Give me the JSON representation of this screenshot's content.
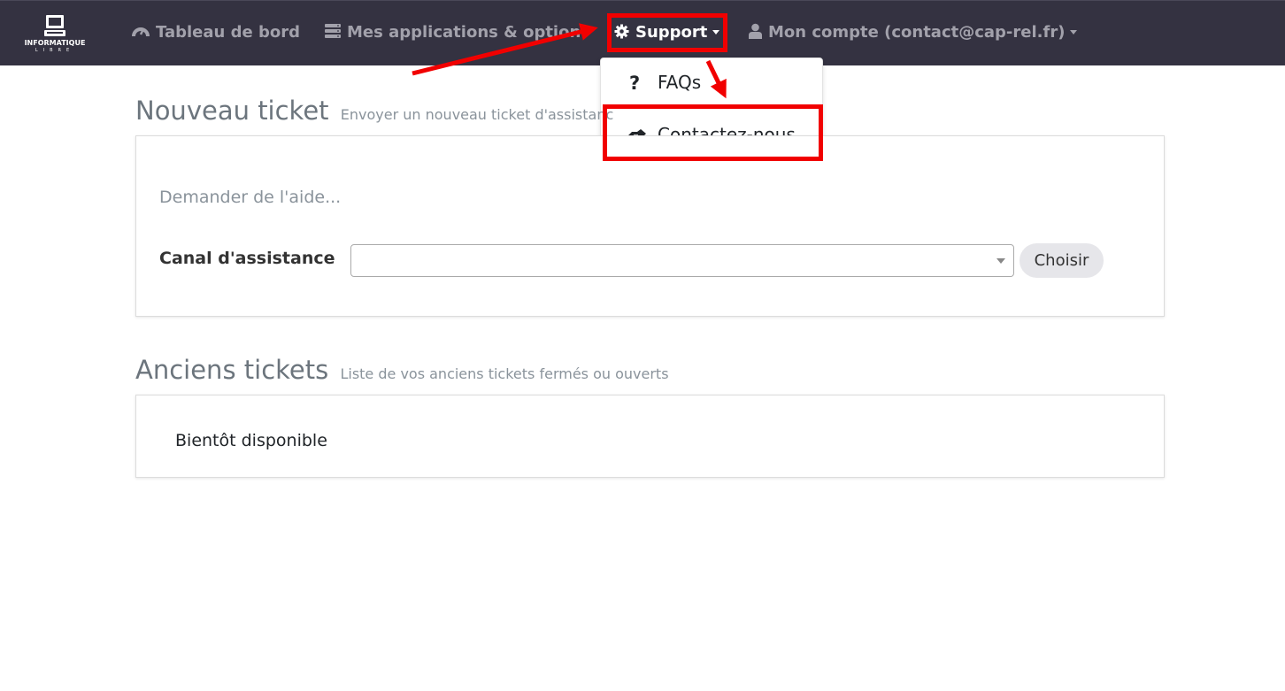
{
  "header": {
    "logo": {
      "title": "INFORMATIQUE",
      "subtitle": "LIBRE"
    },
    "nav": [
      {
        "label": "Tableau de bord",
        "icon": "dashboard-icon"
      },
      {
        "label": "Mes applications & option",
        "icon": "server-icon"
      },
      {
        "label": "Support",
        "icon": "gear-icon"
      },
      {
        "label": "Mon compte (contact@cap-rel.fr)",
        "icon": "user-icon"
      }
    ]
  },
  "support_menu": {
    "items": [
      {
        "label": "FAQs",
        "icon": "question-icon"
      },
      {
        "label": "Contactez-nous",
        "icon": "handshake-icon"
      }
    ]
  },
  "new_ticket": {
    "title": "Nouveau ticket",
    "subtitle": "Envoyer un nouveau ticket d'assistanc",
    "prompt": "Demander de l'aide...",
    "channel_label": "Canal d'assistance",
    "channel_value": "",
    "choose_button": "Choisir"
  },
  "old_tickets": {
    "title": "Anciens tickets",
    "subtitle": "Liste de vos anciens tickets fermés ou ouverts",
    "body": "Bientôt disponible"
  },
  "colors": {
    "navbar": "#343241",
    "nav_text": "#a2a1ab",
    "annotation": "#f10000"
  }
}
